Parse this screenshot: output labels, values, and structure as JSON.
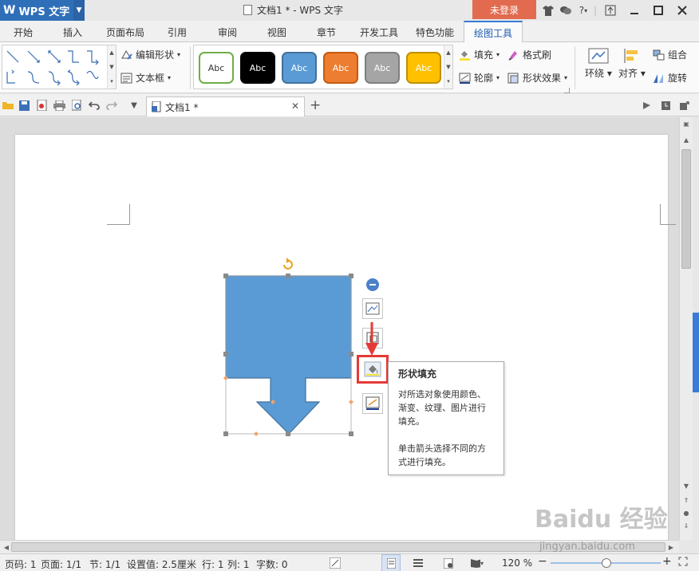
{
  "titlebar": {
    "app_name": "WPS 文字",
    "doc_title": "文档1 * - WPS 文字",
    "login_label": "未登录",
    "help_label": "?"
  },
  "tabs": [
    "开始",
    "插入",
    "页面布局",
    "引用",
    "审阅",
    "视图",
    "章节",
    "开发工具",
    "特色功能",
    "绘图工具"
  ],
  "active_tab": "绘图工具",
  "ribbon": {
    "edit_shape_label": "编辑形状",
    "textbox_label": "文本框",
    "styles": [
      {
        "label": "Abc",
        "bg": "#ffffff",
        "border": "#70ad47",
        "color": "#333333"
      },
      {
        "label": "Abc",
        "bg": "#000000",
        "border": "#000000",
        "color": "#ffffff"
      },
      {
        "label": "Abc",
        "bg": "#5b9bd5",
        "border": "#41719c",
        "color": "#ffffff"
      },
      {
        "label": "Abc",
        "bg": "#ed7d31",
        "border": "#c55a11",
        "color": "#ffffff"
      },
      {
        "label": "Abc",
        "bg": "#a5a5a5",
        "border": "#7f7f7f",
        "color": "#ffffff"
      },
      {
        "label": "Abc",
        "bg": "#ffc000",
        "border": "#bf9000",
        "color": "#ffffff"
      }
    ],
    "fill_label": "填充",
    "format_painter_label": "格式刷",
    "outline_label": "轮廓",
    "shape_effects_label": "形状效果",
    "wrap_label": "环绕",
    "align_label": "对齐",
    "group_label": "组合",
    "rotate_label": "旋转"
  },
  "doc_tab": {
    "label": "文档1 *"
  },
  "shape": {
    "fill_color": "#5b9bd5"
  },
  "tooltip": {
    "title": "形状填充",
    "line1": "对所选对象使用颜色、渐变、纹理、图片进行填充。",
    "line2": "单击箭头选择不同的方式进行填充。"
  },
  "statusbar": {
    "page_code": "页码: 1",
    "page": "页面: 1/1",
    "section": "节: 1/1",
    "setting": "设置值: 2.5厘米",
    "row": "行: 1",
    "col": "列: 1",
    "word_count": "字数: 0",
    "zoom": "120 %"
  },
  "watermark": {
    "brand": "Baidu 经验",
    "url": "jingyan.baidu.com"
  },
  "colors": {
    "accent": "#3a7bd5",
    "highlight": "#e53935",
    "login": "#e26b4f"
  }
}
